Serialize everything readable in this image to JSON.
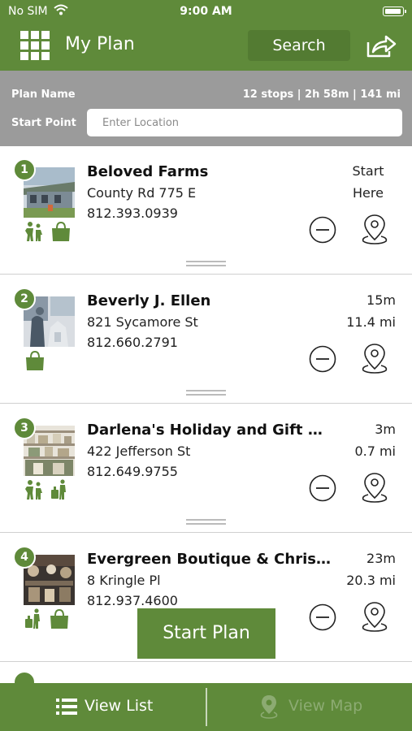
{
  "status_bar": {
    "carrier": "No SIM",
    "time": "9:00 AM"
  },
  "header": {
    "title": "My Plan",
    "search_label": "Search"
  },
  "plan": {
    "name_label": "Plan Name",
    "summary": "12 stops | 2h 58m | 141 mi",
    "start_label": "Start Point",
    "start_placeholder": "Enter Location",
    "start_value": ""
  },
  "stops": [
    {
      "number": "1",
      "name": "Beloved Farms",
      "address": "County Rd 775 E",
      "phone": "812.393.0939",
      "time": "Start",
      "distance": "Here",
      "categories": [
        "family-icon",
        "shopping-bag-icon"
      ]
    },
    {
      "number": "2",
      "name": "Beverly J. Ellen",
      "address": "821 Sycamore St",
      "phone": "812.660.2791",
      "time": "15m",
      "distance": "11.4 mi",
      "categories": [
        "shopping-bag-icon"
      ]
    },
    {
      "number": "3",
      "name": "Darlena's Holiday and Gift Sh...",
      "address": "422 Jefferson St",
      "phone": "812.649.9755",
      "time": "3m",
      "distance": "0.7 mi",
      "categories": [
        "family-icon",
        "luggage-icon"
      ]
    },
    {
      "number": "4",
      "name": "Evergreen Boutique & Christm...",
      "address": "8 Kringle Pl",
      "phone": "812.937.4600",
      "time": "23m",
      "distance": "20.3 mi",
      "categories": [
        "luggage-icon",
        "shopping-bag-icon"
      ]
    }
  ],
  "start_plan_label": "Start Plan",
  "bottom_tabs": {
    "list_label": "View List",
    "map_label": "View Map"
  },
  "colors": {
    "brand_green": "#5f8a3a",
    "search_btn": "#537b32",
    "plan_bar": "#9b9b9b",
    "map_tab_inactive": "#8cab72"
  }
}
